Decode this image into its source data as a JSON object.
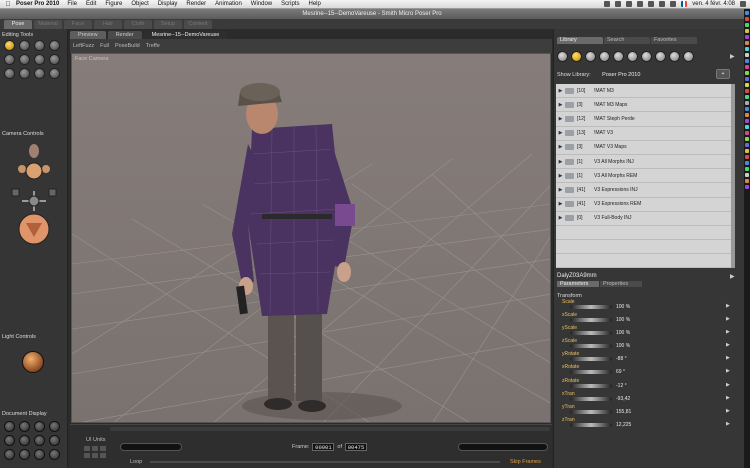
{
  "menubar": {
    "app_name": "Poser Pro 2010",
    "items": [
      "File",
      "Edit",
      "Figure",
      "Object",
      "Display",
      "Render",
      "Animation",
      "Window",
      "Scripts",
      "Help"
    ],
    "clock": "ven. 4 févr.  4:08"
  },
  "window": {
    "title": "Mesrine--15--DemoVareuse - Smith Micro Poser Pro"
  },
  "rooms": [
    "Pose",
    "Material",
    "Face",
    "Hair",
    "Cloth",
    "Setup",
    "Content"
  ],
  "left_panel": {
    "editing_tools_label": "Editing Tools",
    "camera_controls_label": "Camera Controls",
    "light_controls_label": "Light Controls",
    "document_display_label": "Document Display"
  },
  "viewport": {
    "tabs": [
      "Preview",
      "Render"
    ],
    "document_name": "Mesrine--15--DemoVareuse",
    "toolbar": [
      "LeftFuzz",
      "Full",
      "PoseBuild",
      "Treffe"
    ],
    "camera_label": "Face Camera"
  },
  "animation": {
    "ul_label": "UI Units",
    "frame_label": "Frame:",
    "frame_current": "00001",
    "frame_of": "of",
    "frame_total": "00475",
    "loop_label": "Loop",
    "skip_frames_label": "Skip Frames"
  },
  "library": {
    "tabs": [
      "Library",
      "Search",
      "Favorites"
    ],
    "show_library_label": "Show Library:",
    "show_library_value": "Poser Pro 2010",
    "items": [
      {
        "count": "[10]",
        "name": "!MAT M3"
      },
      {
        "count": "[3]",
        "name": "!MAT M3 Maps"
      },
      {
        "count": "[12]",
        "name": "!MAT Steph Perde"
      },
      {
        "count": "[13]",
        "name": "!MAT V3"
      },
      {
        "count": "[3]",
        "name": "!MAT V3 Maps"
      },
      {
        "count": "[1]",
        "name": "V3 All Morphs INJ"
      },
      {
        "count": "[1]",
        "name": "V3 All Morphs REM"
      },
      {
        "count": "[41]",
        "name": "V3 Expressions INJ"
      },
      {
        "count": "[41]",
        "name": "V3 Expressions REM"
      },
      {
        "count": "[0]",
        "name": "V3 Full-Body INJ"
      },
      {
        "count": "",
        "name": ""
      },
      {
        "count": "",
        "name": ""
      },
      {
        "count": "",
        "name": ""
      }
    ]
  },
  "properties": {
    "object_name": "DalyZ03A9mm",
    "tabs": [
      "Parameters",
      "Properties"
    ],
    "group_label": "Transform",
    "params": [
      {
        "name": "Scale",
        "value": "100 %"
      },
      {
        "name": "xScale",
        "value": "100 %"
      },
      {
        "name": "yScale",
        "value": "100 %"
      },
      {
        "name": "zScale",
        "value": "100 %"
      },
      {
        "name": "yRotate",
        "value": "-88 °"
      },
      {
        "name": "xRotate",
        "value": "69 °"
      },
      {
        "name": "zRotate",
        "value": "-12 °"
      },
      {
        "name": "xTran",
        "value": "-93,42"
      },
      {
        "name": "yTran",
        "value": "155,81"
      },
      {
        "name": "zTran",
        "value": "12,225"
      }
    ]
  }
}
